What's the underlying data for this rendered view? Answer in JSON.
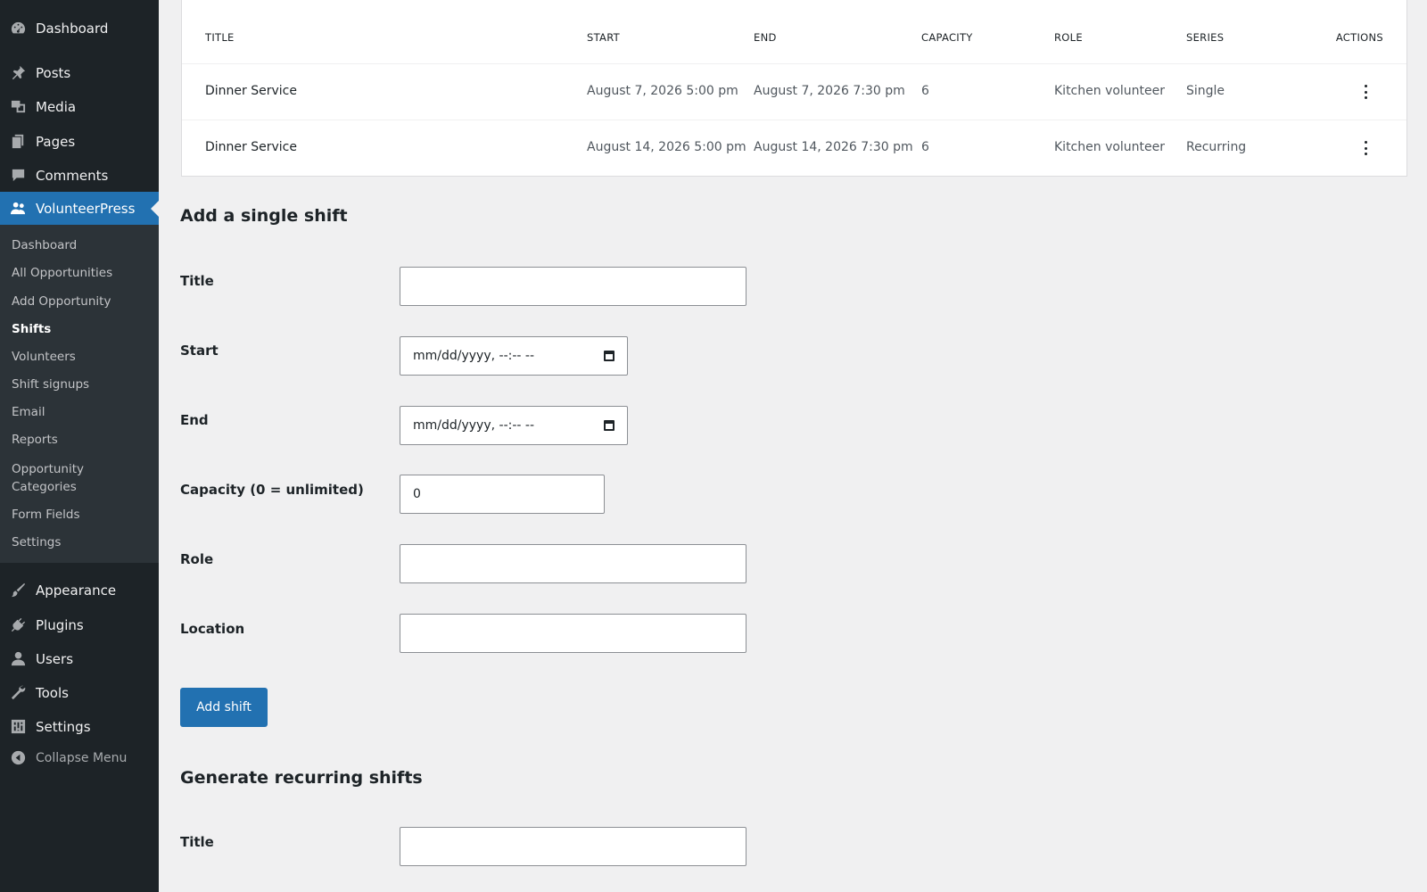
{
  "sidebar": {
    "top_items": [
      {
        "label": "Dashboard",
        "icon": "dashboard-icon"
      },
      {
        "label": "Posts",
        "icon": "pin-icon"
      },
      {
        "label": "Media",
        "icon": "media-icon"
      },
      {
        "label": "Pages",
        "icon": "pages-icon"
      },
      {
        "label": "Comments",
        "icon": "comment-icon"
      },
      {
        "label": "VolunteerPress",
        "icon": "people-icon"
      }
    ],
    "submenu": [
      "Dashboard",
      "All Opportunities",
      "Add Opportunity",
      "Shifts",
      "Volunteers",
      "Shift signups",
      "Email",
      "Reports",
      "Opportunity Categories",
      "Form Fields",
      "Settings"
    ],
    "active_submenu": "Shifts",
    "bottom_items": [
      {
        "label": "Appearance",
        "icon": "brush-icon"
      },
      {
        "label": "Plugins",
        "icon": "plug-icon"
      },
      {
        "label": "Users",
        "icon": "user-icon"
      },
      {
        "label": "Tools",
        "icon": "wrench-icon"
      },
      {
        "label": "Settings",
        "icon": "sliders-icon"
      },
      {
        "label": "Collapse Menu",
        "icon": "collapse-icon"
      }
    ]
  },
  "table": {
    "headers": [
      "TITLE",
      "START",
      "END",
      "CAPACITY",
      "ROLE",
      "SERIES",
      "ACTIONS"
    ],
    "rows": [
      {
        "title": "Dinner Service",
        "start": "August 7, 2026 5:00 pm",
        "end": "August 7, 2026 7:30 pm",
        "capacity": "6",
        "role": "Kitchen volunteer",
        "series": "Single"
      },
      {
        "title": "Dinner Service",
        "start": "August 14, 2026 5:00 pm",
        "end": "August 14, 2026 7:30 pm",
        "capacity": "6",
        "role": "Kitchen volunteer",
        "series": "Recurring"
      }
    ]
  },
  "single_shift": {
    "heading": "Add a single shift",
    "title_label": "Title",
    "start_label": "Start",
    "end_label": "End",
    "date_placeholder": "mm/dd/yyyy, --:-- --",
    "capacity_label": "Capacity (0 = unlimited)",
    "capacity_value": "0",
    "role_label": "Role",
    "location_label": "Location",
    "submit_label": "Add shift"
  },
  "recurring": {
    "heading": "Generate recurring shifts",
    "title_label": "Title"
  },
  "colors": {
    "sidebar_bg": "#1d2327",
    "submenu_bg": "#2c3338",
    "accent": "#2271b1"
  }
}
